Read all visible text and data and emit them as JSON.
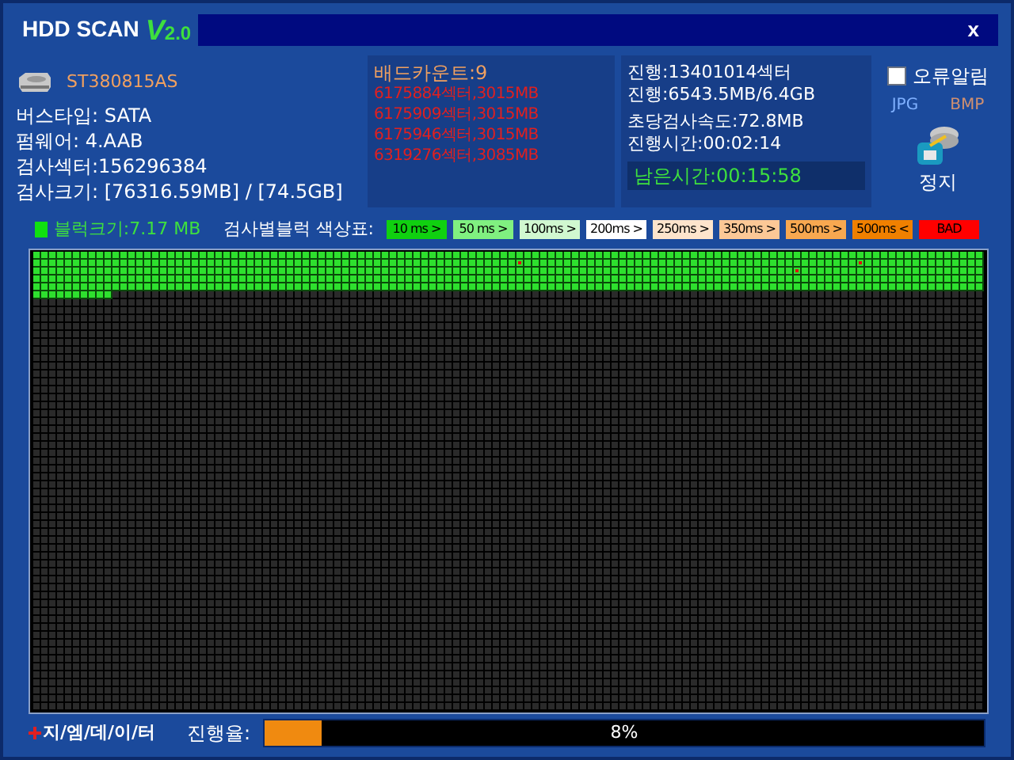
{
  "window": {
    "title": "HDD SCAN",
    "version_mark": "V",
    "version": "2.0",
    "close": "x"
  },
  "drive": {
    "model": "ST380815AS",
    "info": [
      "버스타입: SATA",
      "펌웨어: 4.AAB",
      "검사섹터:156296384",
      "검사크기: [76316.59MB] / [74.5GB]"
    ]
  },
  "bad": {
    "title": "배드카운트:9",
    "sectors": [
      "6175884섹터,3015MB",
      "6175909섹터,3015MB",
      "6175946섹터,3015MB",
      "6319276섹터,3085MB"
    ]
  },
  "progress_info": {
    "lines": [
      "진행:13401014섹터",
      "진행:6543.5MB/6.4GB",
      "초당검사속도:72.8MB",
      "진행시간:00:02:14"
    ],
    "remaining": "남은시간:00:15:58"
  },
  "options": {
    "alert": {
      "label": "오류알림",
      "checked": false
    },
    "formats": [
      "JPG",
      "BMP"
    ],
    "stop": "정지"
  },
  "block_size": "블럭크기:7.17 MB",
  "legend": {
    "title": "검사별블럭 색상표:",
    "items": [
      {
        "label": "10 ms >",
        "color": "#10d010"
      },
      {
        "label": "50 ms >",
        "color": "#80f080"
      },
      {
        "label": "100ms >",
        "color": "#d0f8d0"
      },
      {
        "label": "200ms >",
        "color": "#ffffff"
      },
      {
        "label": "250ms >",
        "color": "#fde4cc"
      },
      {
        "label": "350ms >",
        "color": "#fcc896"
      },
      {
        "label": "500ms >",
        "color": "#f8a850"
      },
      {
        "label": "500ms <",
        "color": "#f08000"
      },
      {
        "label": "BAD",
        "color": "#ff0000"
      }
    ]
  },
  "footer": {
    "brand": "지/엠/데/이/터",
    "progress_label": "진행율:",
    "progress": {
      "level": 0.08,
      "text": "8%"
    }
  }
}
